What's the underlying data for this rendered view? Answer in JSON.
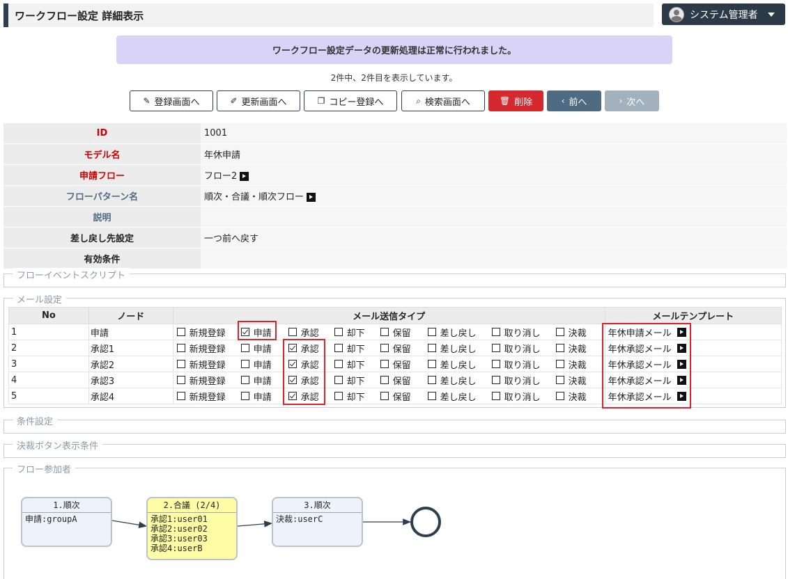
{
  "header": {
    "title": "ワークフロー設定 詳細表示",
    "user": "システム管理者"
  },
  "notice": "ワークフロー設定データの更新処理は正常に行われました。",
  "count_text": "2件中、2件目を表示しています。",
  "buttons": {
    "register": "登録画面へ",
    "update": "更新画面へ",
    "copy": "コピー登録へ",
    "search": "検索画面へ",
    "delete": "削除",
    "prev": "前へ",
    "next": "次へ"
  },
  "detail": [
    {
      "label": "ID",
      "value": "1001"
    },
    {
      "label": "モデル名",
      "value": "年休申請"
    },
    {
      "label": "申請フロー",
      "value": "フロー2"
    },
    {
      "label": "フローパターン名",
      "value": "順次・合議・順次フロー"
    },
    {
      "label": "説明",
      "value": ""
    },
    {
      "label": "差し戻し先設定",
      "value": "一つ前へ戻す"
    },
    {
      "label": "有効条件",
      "value": ""
    }
  ],
  "sections": {
    "flow_event_script": "フローイベントスクリプト",
    "mail_settings": "メール設定",
    "condition_settings": "条件設定",
    "decision_button": "決裁ボタン表示条件",
    "participants": "フロー参加者"
  },
  "mail_table": {
    "headers": {
      "no": "No",
      "node": "ノード",
      "types": "メール送信タイプ",
      "template": "メールテンプレート"
    },
    "type_labels": [
      "新規登録",
      "申請",
      "承認",
      "却下",
      "保留",
      "差し戻し",
      "取り消し",
      "決裁"
    ],
    "rows": [
      {
        "no": "1",
        "node": "申請",
        "checked": [
          false,
          true,
          false,
          false,
          false,
          false,
          false,
          false
        ],
        "template": "年休申請メール"
      },
      {
        "no": "2",
        "node": "承認1",
        "checked": [
          false,
          false,
          true,
          false,
          false,
          false,
          false,
          false
        ],
        "template": "年休承認メール"
      },
      {
        "no": "3",
        "node": "承認2",
        "checked": [
          false,
          false,
          true,
          false,
          false,
          false,
          false,
          false
        ],
        "template": "年休承認メール"
      },
      {
        "no": "4",
        "node": "承認3",
        "checked": [
          false,
          false,
          true,
          false,
          false,
          false,
          false,
          false
        ],
        "template": "年休承認メール"
      },
      {
        "no": "5",
        "node": "承認4",
        "checked": [
          false,
          false,
          true,
          false,
          false,
          false,
          false,
          false
        ],
        "template": "年休承認メール"
      }
    ]
  },
  "flow_nodes": [
    {
      "title": "1.順次",
      "lines": [
        "申請:groupA"
      ]
    },
    {
      "title": "2.合議 (2/4)",
      "lines": [
        "承認1:user01",
        "承認2:user02",
        "承認3:user03",
        "承認4:userB"
      ]
    },
    {
      "title": "3.順次",
      "lines": [
        "決裁:userC"
      ]
    }
  ],
  "colors": {
    "accent_dark": "#2c3e50",
    "danger": "#d3292f",
    "slate": "#4f6b82",
    "notice_bg": "#d9d4f7",
    "highlight": "#d8232a",
    "node_yellow": "#fffca6"
  }
}
